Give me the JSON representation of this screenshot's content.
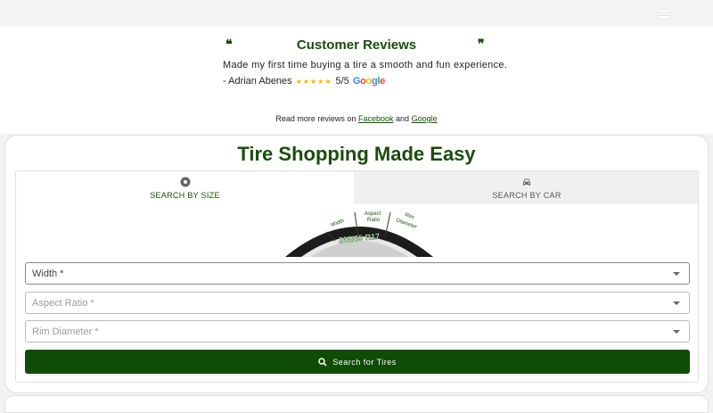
{
  "reviews": {
    "open_quote": "❝",
    "close_quote": "❞",
    "title": "Customer Reviews",
    "text": "Made my first time buying a tire a smooth and fun experience.",
    "author": "- Adrian Abenes",
    "stars": "★★★★★",
    "rating": "5/5",
    "brand": {
      "g": "G",
      "o1": "o",
      "o2": "o",
      "g2": "g",
      "l": "l",
      "e": "e"
    },
    "read_more_prefix": "Read more reviews on",
    "facebook": "Facebook",
    "and": "and",
    "google_link": "Google"
  },
  "tool": {
    "title": "Tire Shopping Made Easy",
    "tabs": [
      {
        "label": "SEARCH BY SIZE",
        "icon": "tire-icon"
      },
      {
        "label": "SEARCH BY CAR",
        "icon": "car-icon"
      }
    ],
    "diagram": {
      "width_label": "Width",
      "aspect_label_1": "Aspect",
      "aspect_label_2": "Ratio",
      "rim_label_1": "Rim",
      "rim_label_2": "Diameter",
      "size_text": "265/65 R17"
    },
    "fields": [
      {
        "label": "Width *"
      },
      {
        "label": "Aspect Ratio *"
      },
      {
        "label": "Rim Diameter *"
      }
    ],
    "search_label": "Search for Tires"
  },
  "colors": {
    "brand_green": "#1a4d0c",
    "button_green": "#0f4c07"
  }
}
